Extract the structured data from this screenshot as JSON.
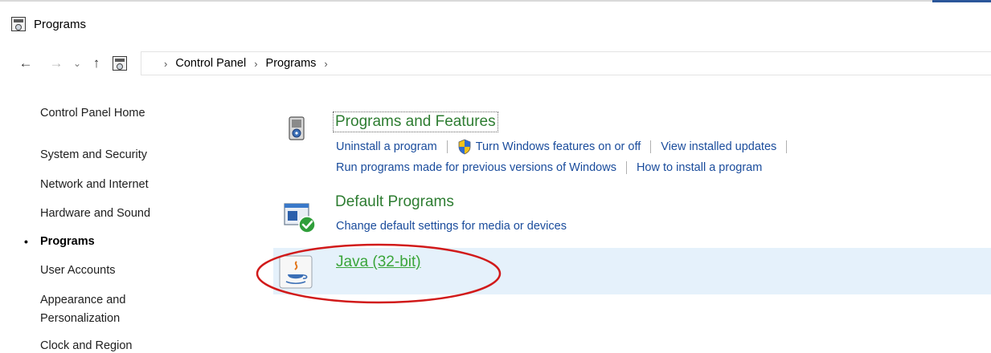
{
  "window": {
    "title": "Programs"
  },
  "address": {
    "back_icon": "back-arrow-icon",
    "forward_icon": "forward-arrow-icon",
    "recent_icon": "chevron-down-icon",
    "up_icon": "up-arrow-icon",
    "breadcrumbs": [
      "Control Panel",
      "Programs"
    ]
  },
  "sidebar": {
    "items": [
      {
        "label": "Control Panel Home"
      },
      {
        "label": "System and Security"
      },
      {
        "label": "Network and Internet"
      },
      {
        "label": "Hardware and Sound"
      },
      {
        "label": "Programs",
        "active": true
      },
      {
        "label": "User Accounts"
      },
      {
        "label": "Appearance and"
      },
      {
        "label": "Personalization"
      },
      {
        "label": "Clock and Region"
      }
    ]
  },
  "categories": {
    "programs_features": {
      "title": "Programs and Features",
      "links": [
        "Uninstall a program",
        "Turn Windows features on or off",
        "View installed updates",
        "Run programs made for previous versions of Windows",
        "How to install a program"
      ]
    },
    "default_programs": {
      "title": "Default Programs",
      "links": [
        "Change default settings for media or devices"
      ]
    },
    "java": {
      "title": "Java (32-bit)"
    }
  },
  "colors": {
    "category_title": "#2e7d32",
    "link": "#1a4c9c",
    "java_highlight": "#e5f1fb",
    "annotation_circle": "#d11a1a"
  }
}
